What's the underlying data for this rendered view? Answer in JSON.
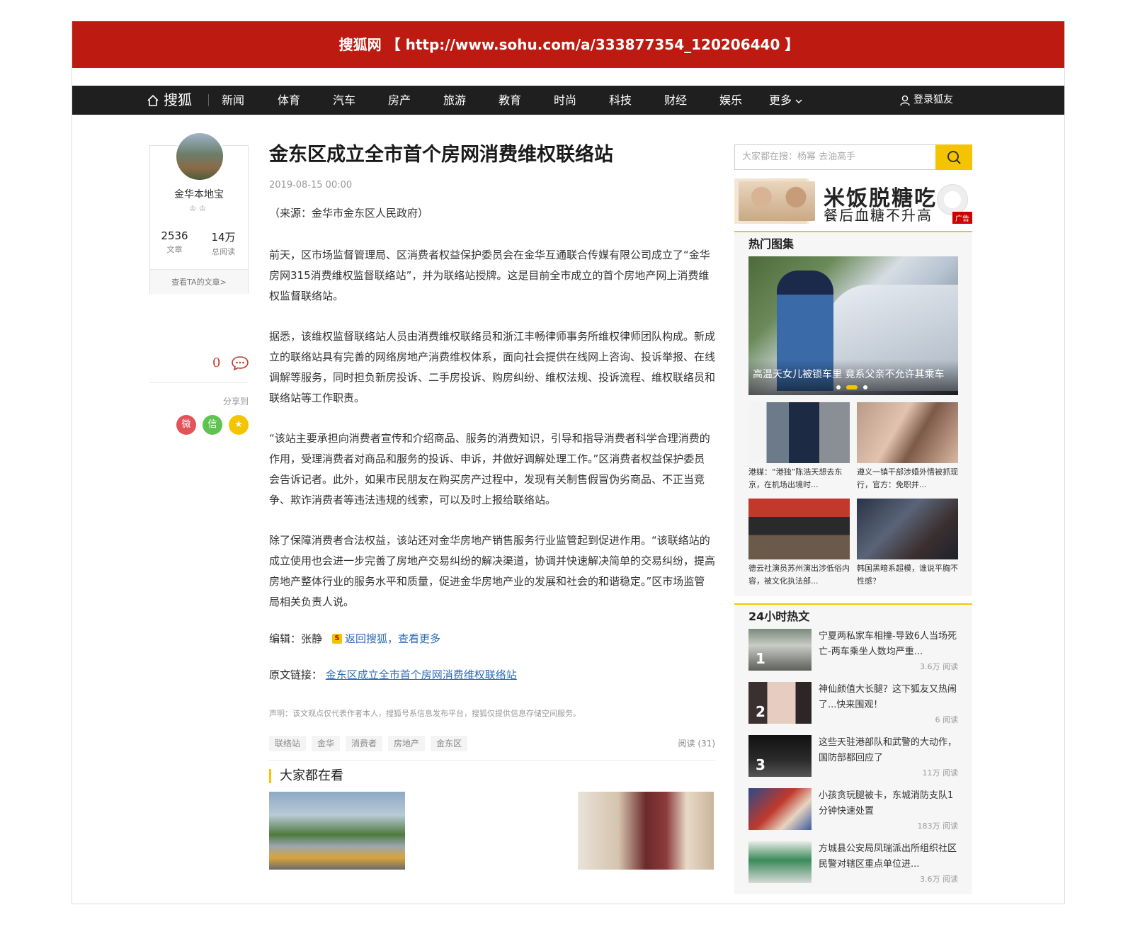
{
  "top_banner": {
    "site": "搜狐网",
    "url_text": "【 http://www.sohu.com/a/333877354_120206440 】"
  },
  "nav": {
    "logo": "搜狐",
    "items": [
      "新闻",
      "体育",
      "汽车",
      "房产",
      "旅游",
      "教育",
      "时尚",
      "科技",
      "财经",
      "娱乐",
      "更多"
    ],
    "login": "登录狐友"
  },
  "author": {
    "name": "金华本地宝",
    "articles_count": "2536",
    "articles_label": "文章",
    "reads_count": "14万",
    "reads_label": "总阅读",
    "view_more": "查看TA的文章>"
  },
  "side": {
    "comment_count": "0",
    "share_label": "分享到"
  },
  "article": {
    "title": "金东区成立全市首个房网消费维权联络站",
    "date": "2019-08-15 00:00",
    "source": "（来源：金华市金东区人民政府）",
    "paragraphs": [
      "前天，区市场监督管理局、区消费者权益保护委员会在金华互通联合传媒有限公司成立了“金华房网315消费维权监督联络站”，并为联络站授牌。这是目前全市成立的首个房地产网上消费维权监督联络站。",
      "据悉，该维权监督联络站人员由消费维权联络员和浙江丰畅律师事务所维权律师团队构成。新成立的联络站具有完善的网络房地产消费维权体系，面向社会提供在线网上咨询、投诉举报、在线调解等服务，同时担负新房投诉、二手房投诉、购房纠纷、维权法规、投诉流程、维权联络员和联络站等工作职责。",
      "“该站主要承担向消费者宣传和介绍商品、服务的消费知识，引导和指导消费者科学合理消费的作用，受理消费者对商品和服务的投诉、申诉，并做好调解处理工作。”区消费者权益保护委员会告诉记者。此外，如果市民朋友在购买房产过程中，发现有关制售假冒伪劣商品、不正当竞争、欺诈消费者等违法违规的线索，可以及时上报给联络站。",
      "除了保障消费者合法权益，该站还对金华房地产销售服务行业监管起到促进作用。“该联络站的成立使用也会进一步完善了房地产交易纠纷的解决渠道，协调并快速解决简单的交易纠纷，提高房地产整体行业的服务水平和质量，促进金华房地产业的发展和社会的和谐稳定。”区市场监管局相关负责人说。"
    ],
    "editor_label": "编辑：张静",
    "back_link": "返回搜狐，查看更多",
    "orig_label": "原文链接：",
    "orig_link": "金东区成立全市首个房网消费维权联络站",
    "declaration": "声明：该文观点仅代表作者本人，搜狐号系信息发布平台，搜狐仅提供信息存储空间服务。",
    "tags": [
      "联络站",
      "金华",
      "消费者",
      "房地产",
      "金东区"
    ],
    "reads": "阅读 (31)",
    "watch_title": "大家都在看"
  },
  "right": {
    "search_placeholder": "大家都在搜：杨幂 去油高手",
    "ad": {
      "line1": "米饭脱糖吃",
      "line2": "餐后血糖不升高",
      "tag": "广告"
    },
    "gallery_title": "热门图集",
    "hero_caption": "高温天女儿被锁车里 竟系父亲不允许其乘车",
    "gallery": [
      {
        "caption": "港媒：“港独”陈浩天想去东京，在机场出境时..."
      },
      {
        "caption": "遵义一镇干部涉婚外情被抓现行，官方：免职并..."
      },
      {
        "caption": "德云社演员苏州演出涉低俗内容，被文化执法部..."
      },
      {
        "caption": "韩国黑暗系超模，谁说平胸不性感？"
      }
    ],
    "hot_title": "24小时热文",
    "hot": [
      {
        "num": "1",
        "title": "宁夏两私家车相撞-导致6人当场死亡-两车乘坐人数均严重...",
        "reads": "3.6万 阅读"
      },
      {
        "num": "2",
        "title": "神仙颜值大长腿？这下狐友又热闹了...快来围观！",
        "reads": "6 阅读"
      },
      {
        "num": "3",
        "title": "这些天驻港部队和武警的大动作，国防部都回应了",
        "reads": "11万 阅读"
      },
      {
        "num": "",
        "title": "小孩贪玩腿被卡，东城消防支队1分钟快速处置",
        "reads": "183万 阅读"
      },
      {
        "num": "",
        "title": "方城县公安局凤瑞派出所组织社区民警对辖区重点单位进...",
        "reads": "3.6万 阅读"
      }
    ]
  }
}
